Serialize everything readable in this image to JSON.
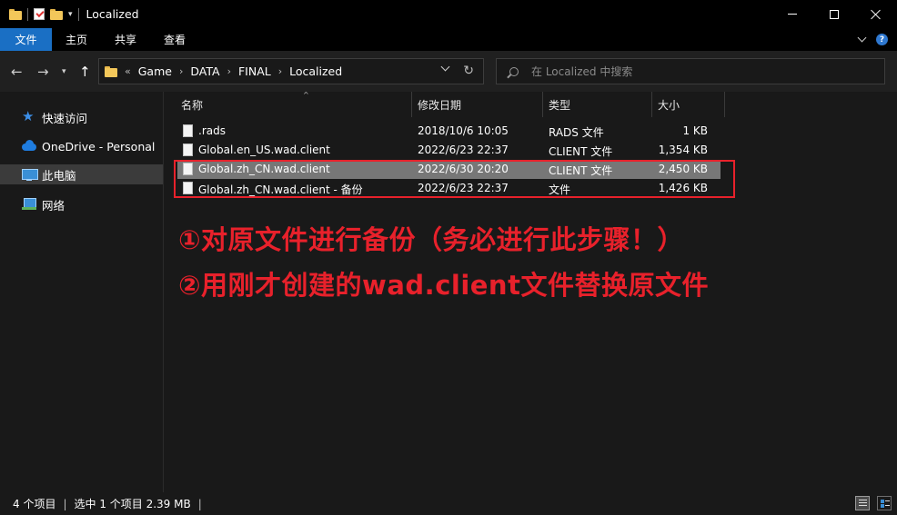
{
  "window": {
    "title": "Localized"
  },
  "ribbon": {
    "tabs": [
      {
        "label": "文件",
        "active": true
      },
      {
        "label": "主页"
      },
      {
        "label": "共享"
      },
      {
        "label": "查看"
      }
    ]
  },
  "nav": {
    "back_icon": "arrow-left-icon",
    "forward_icon": "arrow-right-icon",
    "recent_icon": "chevron-down-icon",
    "up_icon": "arrow-up-icon"
  },
  "address": {
    "overflow": "«",
    "crumbs": [
      "Game",
      "DATA",
      "FINAL",
      "Localized"
    ]
  },
  "search": {
    "placeholder": "在 Localized 中搜索"
  },
  "sidebar": {
    "items": [
      {
        "label": "快速访问",
        "icon": "star-icon"
      },
      {
        "label": "OneDrive - Personal",
        "icon": "cloud-icon"
      },
      {
        "label": "此电脑",
        "icon": "pc-icon",
        "selected": true
      },
      {
        "label": "网络",
        "icon": "network-icon"
      }
    ]
  },
  "columns": {
    "name": "名称",
    "date": "修改日期",
    "type": "类型",
    "size": "大小"
  },
  "files": [
    {
      "name": ".rads",
      "date": "2018/10/6 10:05",
      "type": "RADS 文件",
      "size": "1 KB"
    },
    {
      "name": "Global.en_US.wad.client",
      "date": "2022/6/23 22:37",
      "type": "CLIENT 文件",
      "size": "1,354 KB"
    },
    {
      "name": "Global.zh_CN.wad.client",
      "date": "2022/6/30 20:20",
      "type": "CLIENT 文件",
      "size": "2,450 KB",
      "selected": true
    },
    {
      "name": "Global.zh_CN.wad.client - 备份",
      "date": "2022/6/23 22:37",
      "type": "文件",
      "size": "1,426 KB"
    }
  ],
  "annotation": {
    "line1": "①对原文件进行备份（务必进行此步骤！）",
    "line2": "②用刚才创建的wad.client文件替换原文件",
    "color": "#e8212b"
  },
  "status": {
    "count": "4 个项目",
    "selection": "选中 1 个项目  2.39 MB"
  },
  "colors": {
    "accent": "#1a6fc4",
    "selected_row": "#777777"
  }
}
